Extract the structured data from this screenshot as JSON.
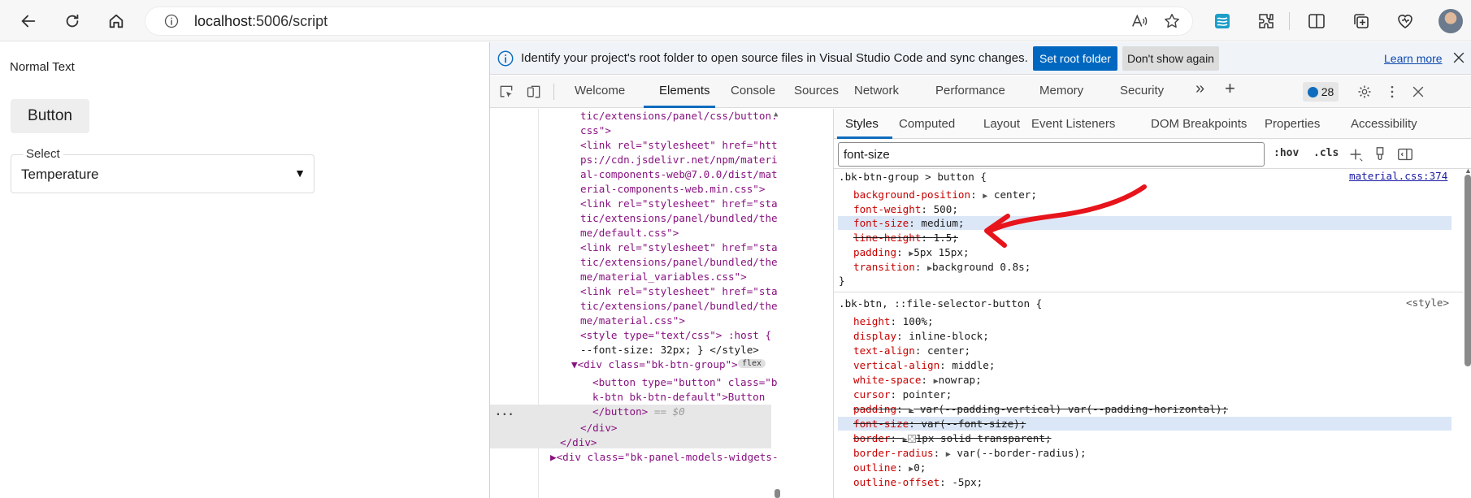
{
  "browser": {
    "url_host": "localhost",
    "url_path": ":5006/script"
  },
  "page": {
    "normal_text": "Normal Text",
    "button_label": "Button",
    "select_label": "Select",
    "select_value": "Temperature",
    "select_arrow": "▼"
  },
  "infobar": {
    "message": "Identify your project's root folder to open source files in Visual Studio Code and sync changes.",
    "set_root_label": "Set root folder",
    "dont_show_label": "Don't show again",
    "learn_more_label": "Learn more"
  },
  "devtools": {
    "tabs": [
      "Welcome",
      "Elements",
      "Console",
      "Sources",
      "Network",
      "Performance",
      "Memory",
      "Security"
    ],
    "active_tab": "Elements",
    "issues_count": "28",
    "more_tabs": "»",
    "add_tab": "+"
  },
  "dom_tree": {
    "lines": [
      "tic/extensions/panel/css/button.",
      "css\">",
      "<link rel=\"stylesheet\" href=\"htt",
      "ps://cdn.jsdelivr.net/npm/materi",
      "al-components-web@7.0.0/dist/mat",
      "erial-components-web.min.css\">",
      "<link rel=\"stylesheet\" href=\"sta",
      "tic/extensions/panel/bundled/the",
      "me/default.css\">",
      "<link rel=\"stylesheet\" href=\"sta",
      "tic/extensions/panel/bundled/the",
      "me/material_variables.css\">",
      "<link rel=\"stylesheet\" href=\"sta",
      "tic/extensions/panel/bundled/the",
      "me/material.css\">",
      "<style type=\"text/css\"> :host {",
      "--font-size: 32px; } </style>",
      "▼<div class=\"bk-btn-group\">",
      "<button type=\"button\" class=\"b",
      "k-btn bk-btn-default\">Button",
      "</button> == $0",
      "</div>",
      "</div>",
      "▶<div class=\"bk-panel-models-widgets-"
    ],
    "flex_badge": "flex",
    "ellipsis": "..."
  },
  "styles": {
    "tabs": [
      "Styles",
      "Computed",
      "Layout",
      "Event Listeners",
      "DOM Breakpoints",
      "Properties",
      "Accessibility"
    ],
    "active_tab": "Styles",
    "filter_value": "font-size",
    "hov_label": ":hov",
    "cls_label": ".cls",
    "rule1": {
      "selector": ".bk-btn-group > button {",
      "source": "material.css:374",
      "decls": [
        {
          "prop": "background-position",
          "value": "center",
          "tri": true,
          "struck": false,
          "highlight": false
        },
        {
          "prop": "font-weight",
          "value": "500",
          "tri": false,
          "struck": false,
          "highlight": false
        },
        {
          "prop": "font-size",
          "value": "medium",
          "tri": false,
          "struck": false,
          "highlight": true
        },
        {
          "prop": "line-height",
          "value": "1.5",
          "tri": false,
          "struck": true,
          "highlight": false
        },
        {
          "prop": "padding",
          "value": "5px 15px",
          "tri": true,
          "struck": false,
          "highlight": false
        },
        {
          "prop": "transition",
          "value": "background 0.8s",
          "tri": true,
          "struck": false,
          "highlight": false
        }
      ],
      "close": "}"
    },
    "rule2": {
      "selector": ".bk-btn, ::file-selector-button {",
      "source": "<style>",
      "decls": [
        {
          "prop": "height",
          "value": "100%",
          "tri": false,
          "struck": false,
          "highlight": false
        },
        {
          "prop": "display",
          "value": "inline-block",
          "tri": false,
          "struck": false,
          "highlight": false
        },
        {
          "prop": "text-align",
          "value": "center",
          "tri": false,
          "struck": false,
          "highlight": false
        },
        {
          "prop": "vertical-align",
          "value": "middle",
          "tri": false,
          "struck": false,
          "highlight": false
        },
        {
          "prop": "white-space",
          "value": "nowrap",
          "tri": true,
          "struck": false,
          "highlight": false
        },
        {
          "prop": "cursor",
          "value": "pointer",
          "tri": false,
          "struck": false,
          "highlight": false
        },
        {
          "prop": "padding",
          "value": "var(--padding-vertical) var(--padding-horizontal)",
          "tri": true,
          "struck": true,
          "highlight": false
        },
        {
          "prop": "font-size",
          "value": "var(--font-size)",
          "tri": false,
          "struck": true,
          "highlight": true
        },
        {
          "prop": "border",
          "value": "1px solid transparent",
          "tri": true,
          "struck": true,
          "highlight": false,
          "swatch": true
        },
        {
          "prop": "border-radius",
          "value": "var(--border-radius)",
          "tri": true,
          "struck": false,
          "highlight": false
        },
        {
          "prop": "outline",
          "value": "0",
          "tri": true,
          "struck": false,
          "highlight": false
        },
        {
          "prop": "outline-offset",
          "value": "-5px",
          "tri": false,
          "struck": false,
          "highlight": false
        }
      ]
    }
  },
  "colors": {
    "accent": "#0f6cbd",
    "annotation": "#e8141b"
  }
}
